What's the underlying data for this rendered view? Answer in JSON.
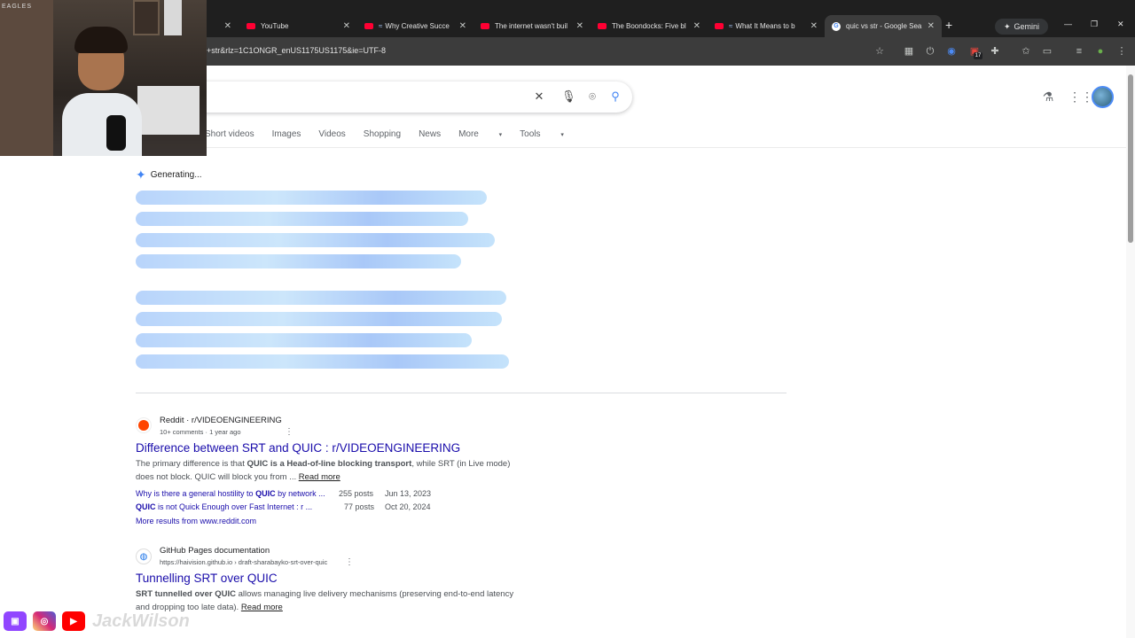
{
  "browser": {
    "tabs": [
      {
        "title": "",
        "favicon": "blank",
        "close": "✕"
      },
      {
        "title": "YouTube",
        "favicon": "youtube-icon",
        "close": "✕"
      },
      {
        "title": "Why Creative Succe",
        "favicon": "youtube-icon",
        "close": "✕"
      },
      {
        "title": "The internet wasn't buil",
        "favicon": "youtube-icon",
        "close": "✕"
      },
      {
        "title": "The Boondocks: Five bl",
        "favicon": "youtube-icon",
        "close": "✕"
      },
      {
        "title": "What It Means to b",
        "favicon": "youtube-icon",
        "close": "✕"
      },
      {
        "title": "quic vs str - Google Sea",
        "favicon": "google-icon",
        "close": "✕"
      }
    ],
    "new_tab": "+",
    "gemini_label": "Gemini",
    "url": "+str&rlz=1C1ONGR_enUS1175US1175&ie=UTF-8",
    "badge_count": "17"
  },
  "google": {
    "nav_tabs": [
      "Short videos",
      "Images",
      "Videos",
      "Shopping",
      "News",
      "More",
      "Tools"
    ],
    "generating_label": "Generating",
    "results": [
      {
        "source": "Reddit · r/VIDEOENGINEERING",
        "meta": "10+ comments · 1 year ago",
        "title": "Difference between SRT and QUIC : r/VIDEOENGINEERING",
        "snippet_pre": "The primary difference is that ",
        "snippet_b1": "QUIC is a Head-of-line blocking transport",
        "snippet_mid": ", while SRT (in Live mode) does not block. QUIC will block you from ... ",
        "read_more": "Read more",
        "sublinks": [
          {
            "text_pre": "Why is there a general hostility to ",
            "text_b": "QUIC",
            "text_post": " by network ...",
            "posts": "255 posts",
            "date": "Jun 13, 2023"
          },
          {
            "text_pre": "",
            "text_b": "QUIC",
            "text_post": " is not Quick Enough over Fast Internet : r ...",
            "posts": "77 posts",
            "date": "Oct 20, 2024"
          }
        ],
        "more_results": "More results from www.reddit.com"
      },
      {
        "source": "GitHub Pages documentation",
        "meta": "https://haivision.github.io › draft-sharabayko-srt-over-quic",
        "title": "Tunnelling SRT over QUIC",
        "snippet_b1": "SRT tunnelled over QUIC",
        "snippet_mid": " allows managing live delivery mechanisms (preserving end-to-end latency and dropping too late data). ",
        "read_more": "Read more"
      }
    ]
  },
  "overlay": {
    "cam_label": "EAGLES",
    "social": [
      "twitch-icon",
      "instagram-icon",
      "youtube-icon"
    ],
    "handle": "JackWilson"
  },
  "colors": {
    "link": "#1a0dab",
    "chrome_dark": "#1f1f1f",
    "gemini_blue": "#4285f4"
  }
}
